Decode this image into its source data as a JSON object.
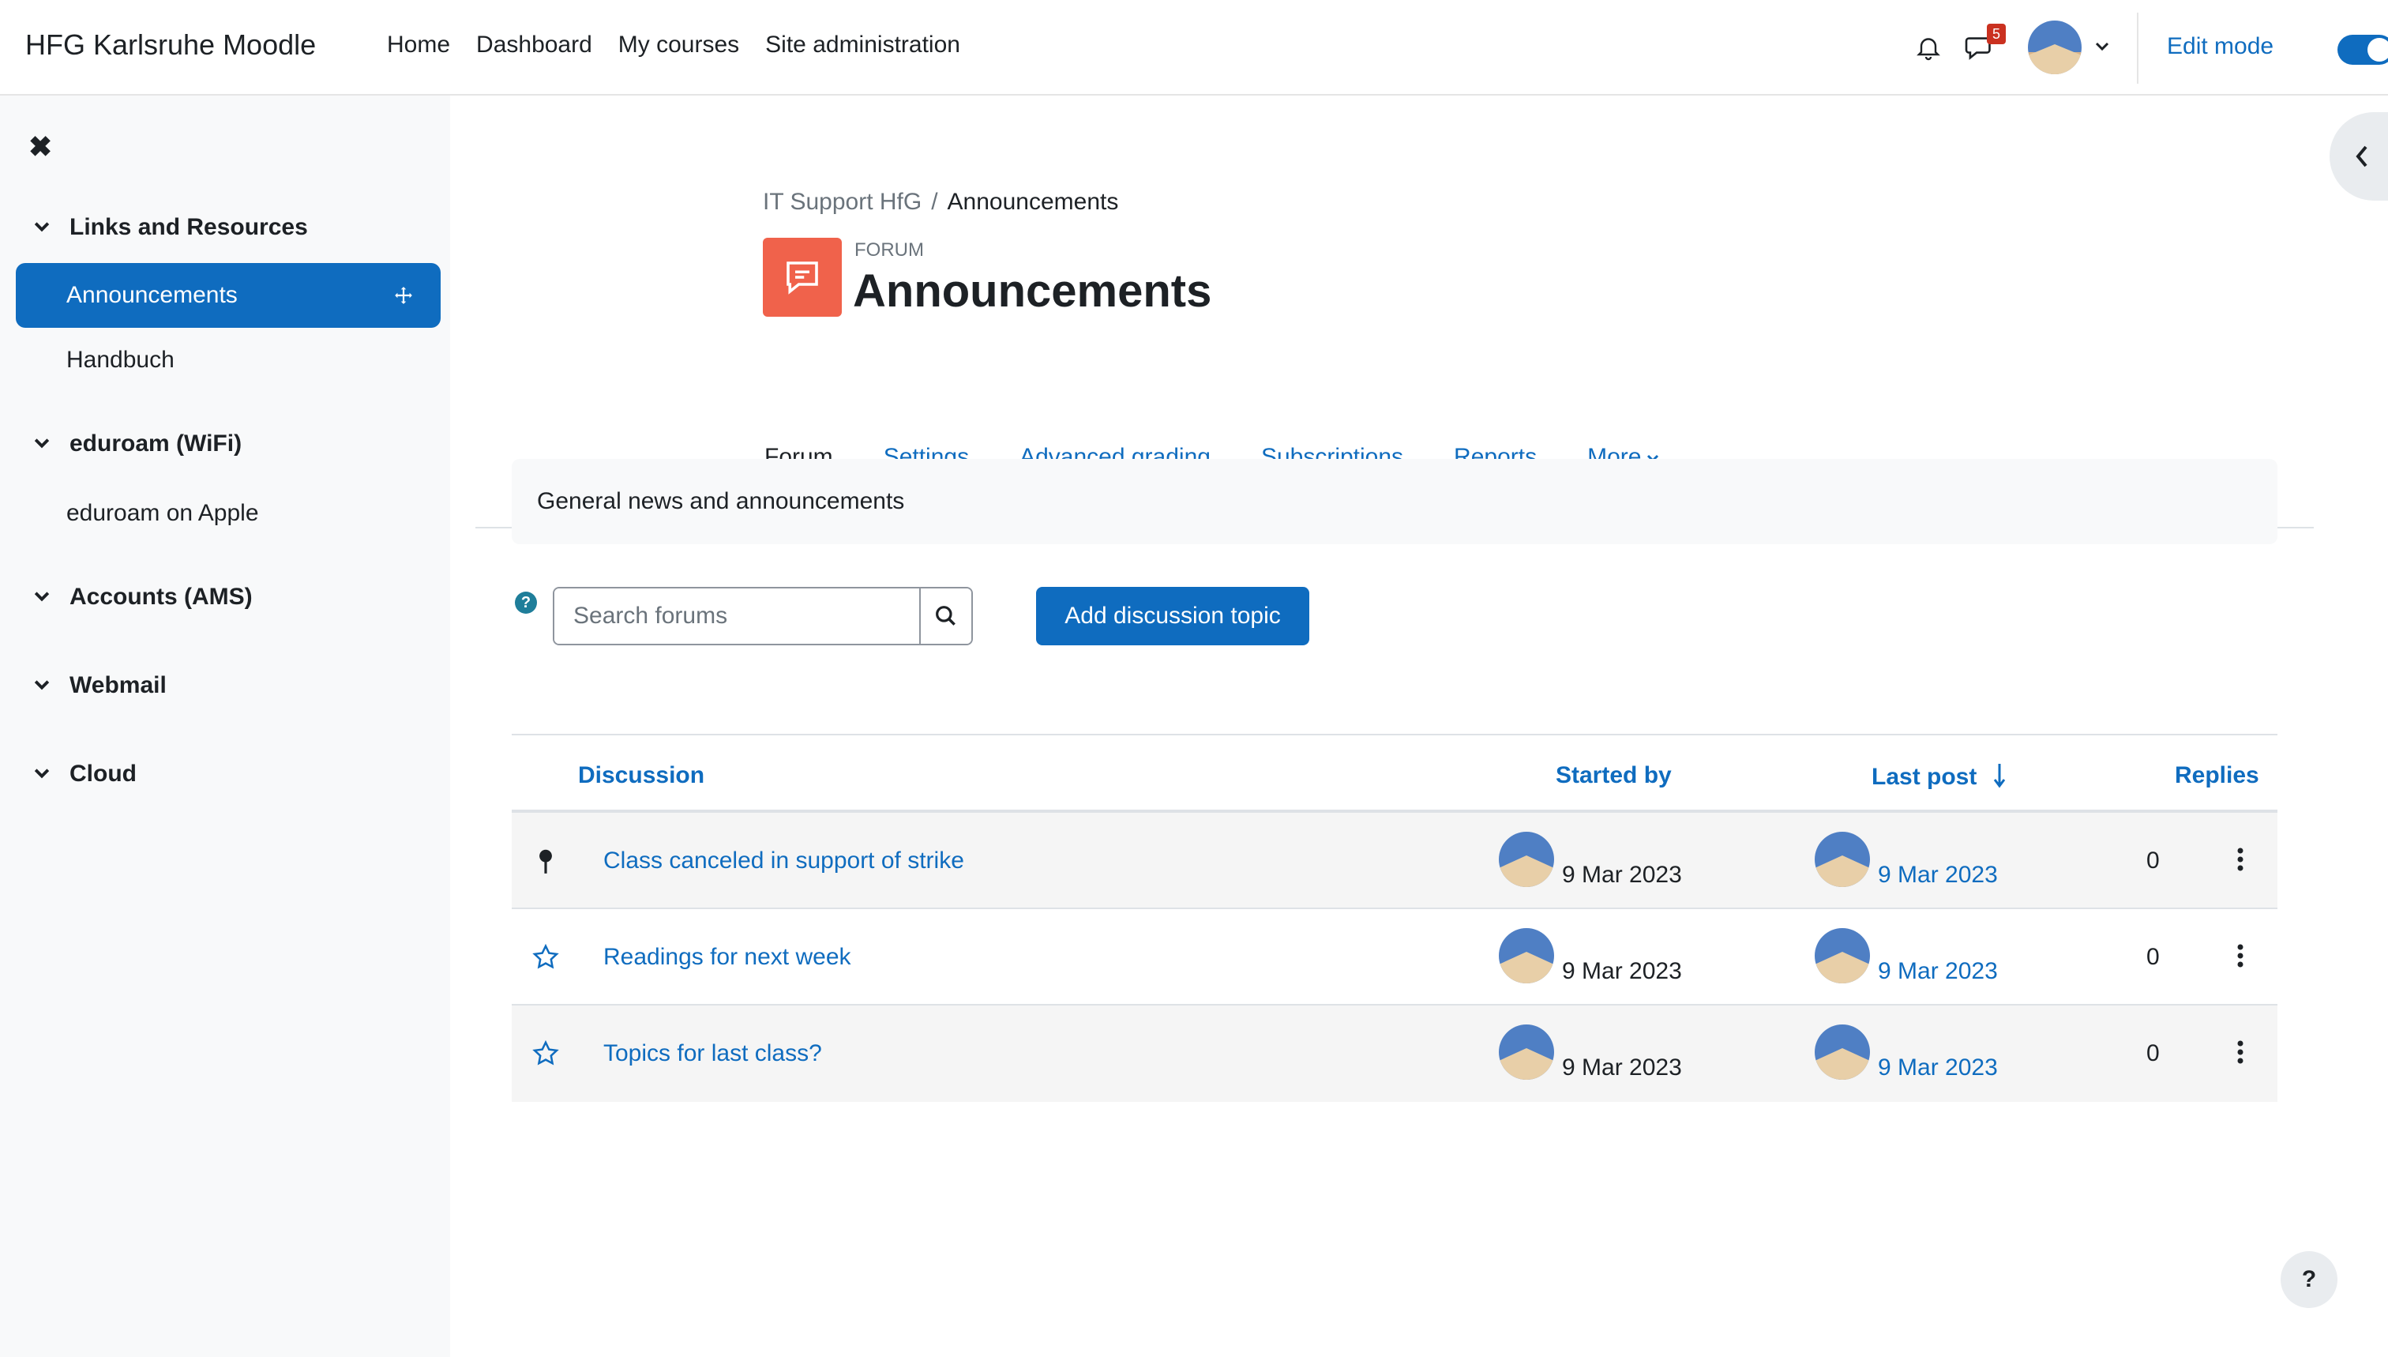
{
  "navbar": {
    "brand": "HFG Karlsruhe Moodle",
    "links": [
      "Home",
      "Dashboard",
      "My courses",
      "Site administration"
    ],
    "messages_badge": "5",
    "edit_mode_label": "Edit mode",
    "edit_mode_on": true
  },
  "drawer": {
    "sections": [
      {
        "title": "Links and Resources",
        "items": [
          "Announcements",
          "Handbuch"
        ]
      },
      {
        "title": "eduroam (WiFi)",
        "items": [
          "eduroam on Apple"
        ]
      },
      {
        "title": "Accounts (AMS)",
        "items": []
      },
      {
        "title": "Webmail",
        "items": []
      },
      {
        "title": "Cloud",
        "items": []
      }
    ]
  },
  "breadcrumb": {
    "parent": "IT Support HfG",
    "separator": "/",
    "current": "Announcements"
  },
  "header": {
    "pretitle": "FORUM",
    "title": "Announcements"
  },
  "tabs": [
    "Forum",
    "Settings",
    "Advanced grading",
    "Subscriptions",
    "Reports",
    "More"
  ],
  "intro": "General news and announcements",
  "search": {
    "placeholder": "Search forums"
  },
  "add_button": "Add discussion topic",
  "table": {
    "headers": {
      "discussion": "Discussion",
      "started_by": "Started by",
      "last_post": "Last post",
      "replies": "Replies"
    },
    "rows": [
      {
        "title": "Class canceled in support of strike",
        "icon": "pin-icon",
        "started": "9 Mar 2023",
        "last_post": "9 Mar 2023",
        "replies": "0"
      },
      {
        "title": "Readings for next week",
        "icon": "star-icon",
        "started": "9 Mar 2023",
        "last_post": "9 Mar 2023",
        "replies": "0"
      },
      {
        "title": "Topics for last class?",
        "icon": "star-icon",
        "started": "9 Mar 2023",
        "last_post": "9 Mar 2023",
        "replies": "0"
      }
    ]
  },
  "help_fab": "?",
  "colors": {
    "primary": "#0f6cbf",
    "forum_icon": "#f0624b",
    "badge": "#ca3120"
  }
}
